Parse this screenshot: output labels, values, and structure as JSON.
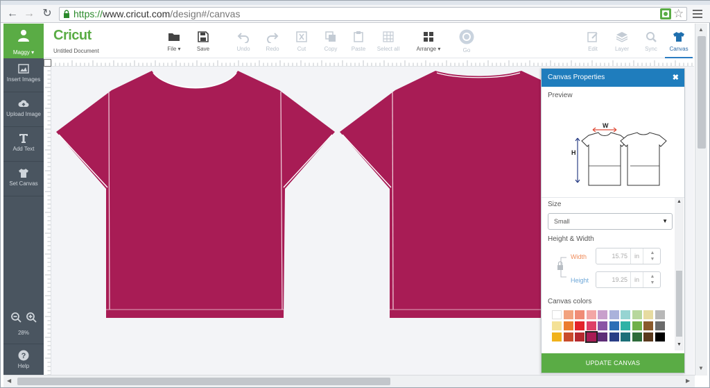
{
  "browser": {
    "url_https": "https://",
    "url_host": "www.cricut.com",
    "url_path": "/design#/canvas"
  },
  "sidebar": {
    "user": "Maggy",
    "items": [
      {
        "label": "Insert Images",
        "icon": "image-icon"
      },
      {
        "label": "Upload Image",
        "icon": "cloud-upload-icon"
      },
      {
        "label": "Add Text",
        "icon": "text-icon"
      },
      {
        "label": "Set Canvas",
        "icon": "shirt-icon"
      }
    ],
    "zoom": "28%",
    "help": "Help"
  },
  "header": {
    "logo": "Cricut",
    "document": "Untitled Document",
    "tools": [
      {
        "label": "File",
        "icon": "folder-icon",
        "state": "enabled",
        "dropdown": true
      },
      {
        "label": "Save",
        "icon": "save-icon",
        "state": "enabled"
      },
      {
        "label": "Undo",
        "icon": "undo-icon",
        "state": "disabled"
      },
      {
        "label": "Redo",
        "icon": "redo-icon",
        "state": "disabled"
      },
      {
        "label": "Cut",
        "icon": "cut-icon",
        "state": "disabled"
      },
      {
        "label": "Copy",
        "icon": "copy-icon",
        "state": "disabled"
      },
      {
        "label": "Paste",
        "icon": "paste-icon",
        "state": "disabled"
      },
      {
        "label": "Select all",
        "icon": "select-all-icon",
        "state": "disabled"
      },
      {
        "label": "Arrange",
        "icon": "arrange-icon",
        "state": "enabled",
        "dropdown": true
      },
      {
        "label": "Go",
        "icon": "go-icon",
        "state": "disabled"
      },
      {
        "label": "Edit",
        "icon": "edit-icon",
        "state": "disabled"
      },
      {
        "label": "Layer",
        "icon": "layers-icon",
        "state": "disabled"
      },
      {
        "label": "Sync",
        "icon": "sync-icon",
        "state": "disabled"
      },
      {
        "label": "Canvas",
        "icon": "shirt-icon",
        "state": "active"
      }
    ]
  },
  "canvas": {
    "shirt_color": "#a81c55"
  },
  "panel": {
    "title": "Canvas Properties",
    "preview_label": "Preview",
    "preview_w": "W",
    "preview_h": "H",
    "size_label": "Size",
    "size_value": "Small",
    "hw_label": "Height & Width",
    "width_label": "Width",
    "width_value": "15.75",
    "height_label": "Height",
    "height_value": "19.25",
    "unit": "in",
    "colors_label": "Canvas colors",
    "update_label": "UPDATE CANVAS",
    "swatches": [
      [
        "#ffffff",
        "#f2a27e",
        "#f08c76",
        "#f3a6a5",
        "#c8a0cc",
        "#aab2db",
        "#96d4d2",
        "#b7d79c",
        "#e7dba0",
        "#b8b8b8"
      ],
      [
        "#f4e196",
        "#eb7c2d",
        "#e3222b",
        "#de3f67",
        "#8a55a4",
        "#2d6fb6",
        "#2fb2a6",
        "#6fb04a",
        "#8a5a2c",
        "#6b6b6b"
      ],
      [
        "#f1b21c",
        "#c94b2b",
        "#b5292e",
        "#a81c55",
        "#5e2d77",
        "#2a3e86",
        "#1c6f78",
        "#2e6b3a",
        "#5a3a1e",
        "#000000"
      ]
    ],
    "selected_swatch": "#a81c55"
  }
}
